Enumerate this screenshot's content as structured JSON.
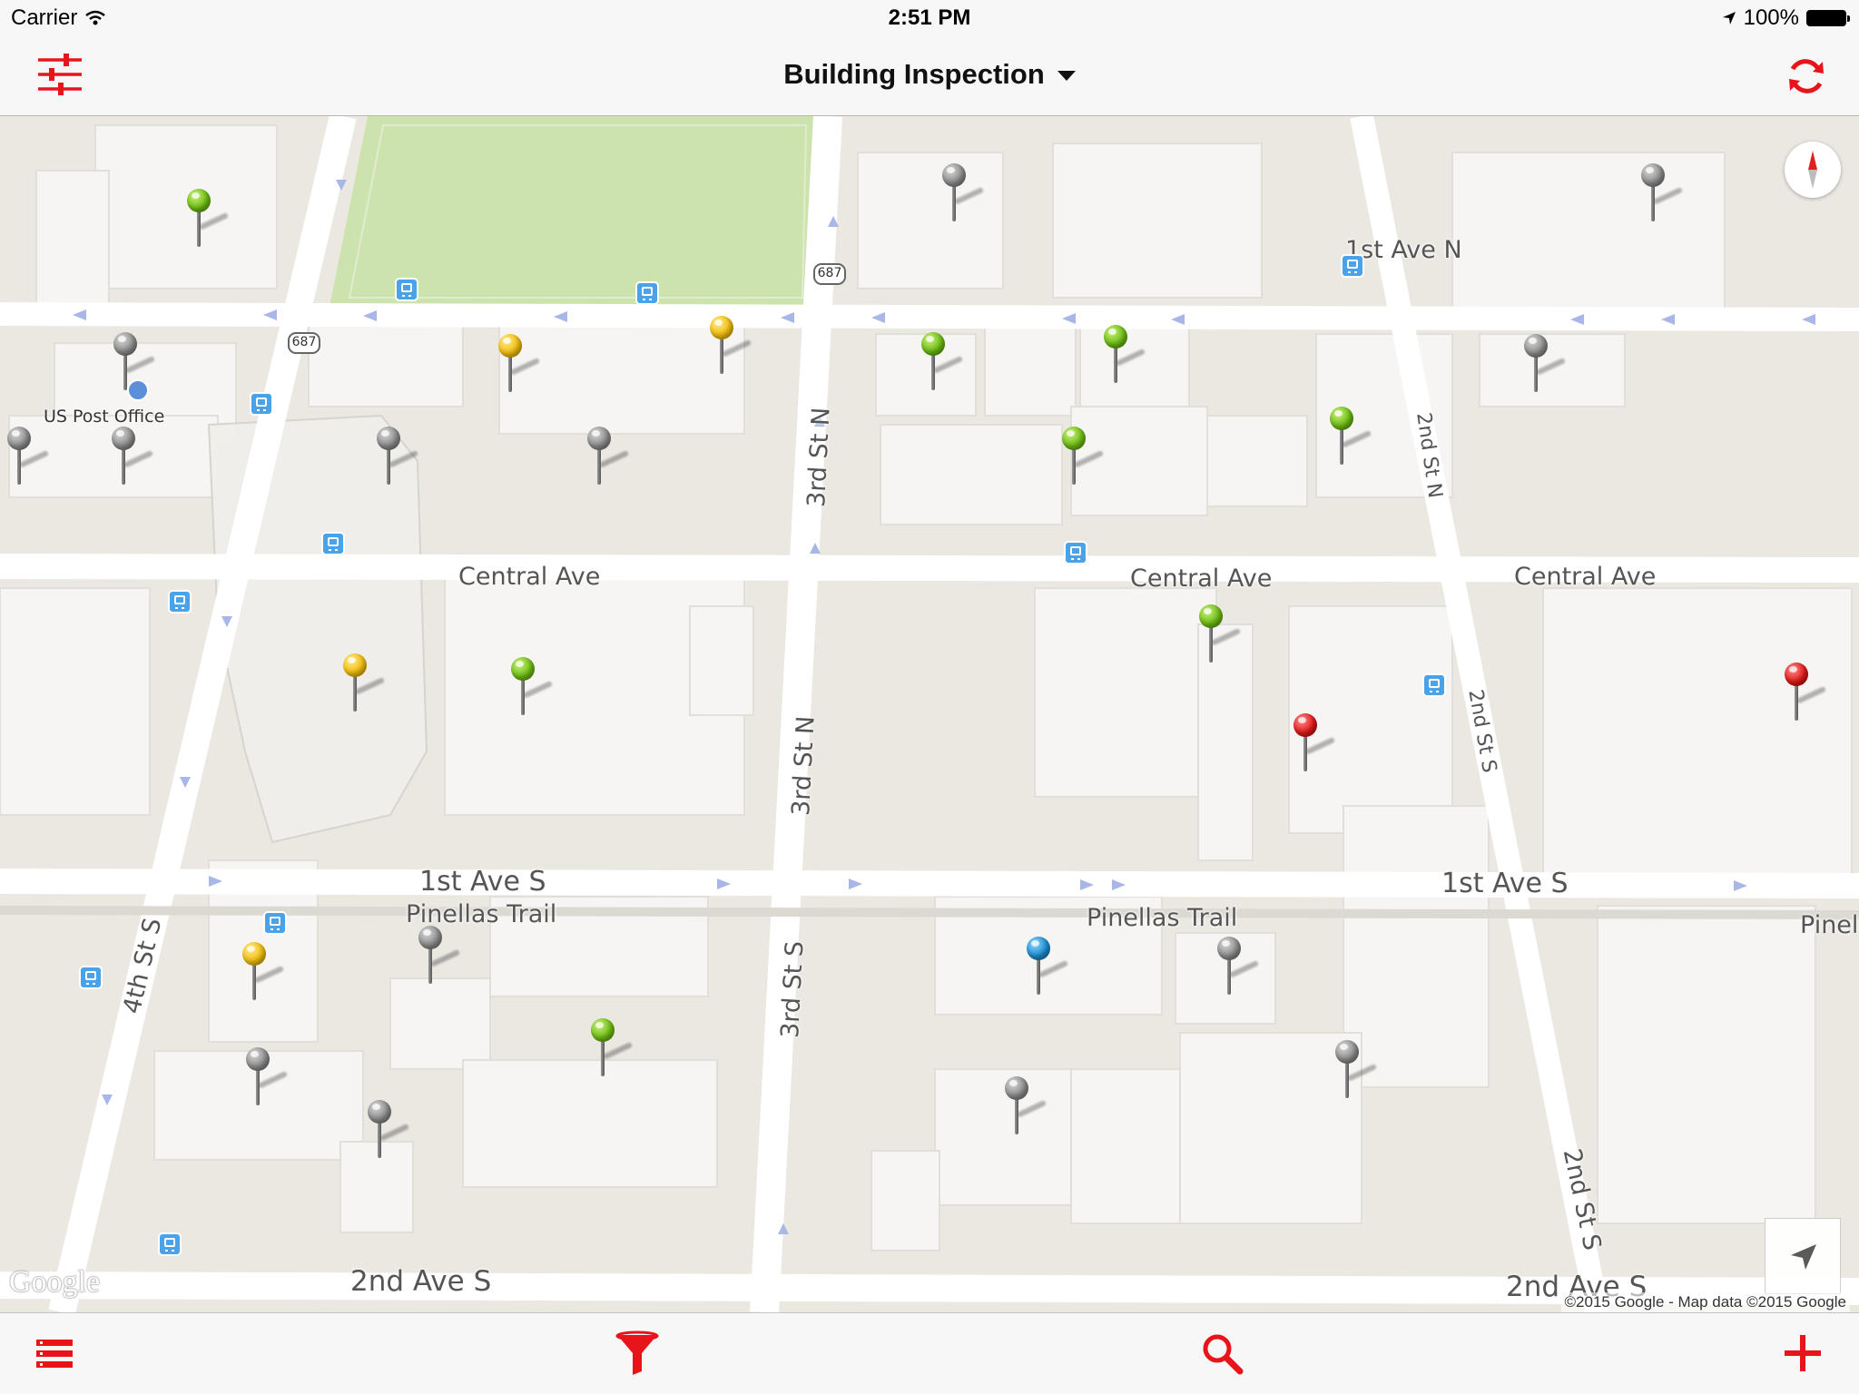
{
  "status_bar": {
    "carrier": "Carrier",
    "time": "2:51 PM",
    "battery": "100%"
  },
  "nav": {
    "title": "Building Inspection",
    "left_icon": "sliders-icon",
    "right_icon": "refresh-icon"
  },
  "map": {
    "streets": {
      "first_ave_n": "1st Ave N",
      "central_ave_1": "Central Ave",
      "central_ave_2": "Central Ave",
      "central_ave_3": "Central Ave",
      "first_ave_s_1": "1st Ave S",
      "first_ave_s_2": "1st Ave S",
      "pinellas_trail_1": "Pinellas Trail",
      "pinellas_trail_2": "Pinellas Trail",
      "pinellas_trail_3": "Pinell",
      "second_ave_s_1": "2nd Ave S",
      "second_ave_s_2": "2nd Ave S",
      "third_st_n_1": "3rd St N",
      "third_st_n_2": "3rd St N",
      "third_st_s": "3rd St S",
      "fourth_st_s": "4th St S",
      "second_st_n": "2nd St N",
      "second_st_s_1": "2nd St S",
      "second_st_s_2": "2nd St S"
    },
    "poi": {
      "post_office": "US Post Office"
    },
    "route_shield": "687",
    "pin_colors": {
      "green": "#6fbe14",
      "gray": "#8e8e8e",
      "yellow": "#f2bf0f",
      "red": "#e11a1a",
      "blue": "#1e8ed1"
    },
    "logo": "Google",
    "attribution": "©2015 Google - Map data ©2015 Google"
  },
  "tab_bar": {
    "accent": "#e8141b",
    "items": [
      {
        "name": "list-icon"
      },
      {
        "name": "filter-icon"
      },
      {
        "name": "search-icon"
      },
      {
        "name": "add-icon"
      }
    ]
  }
}
